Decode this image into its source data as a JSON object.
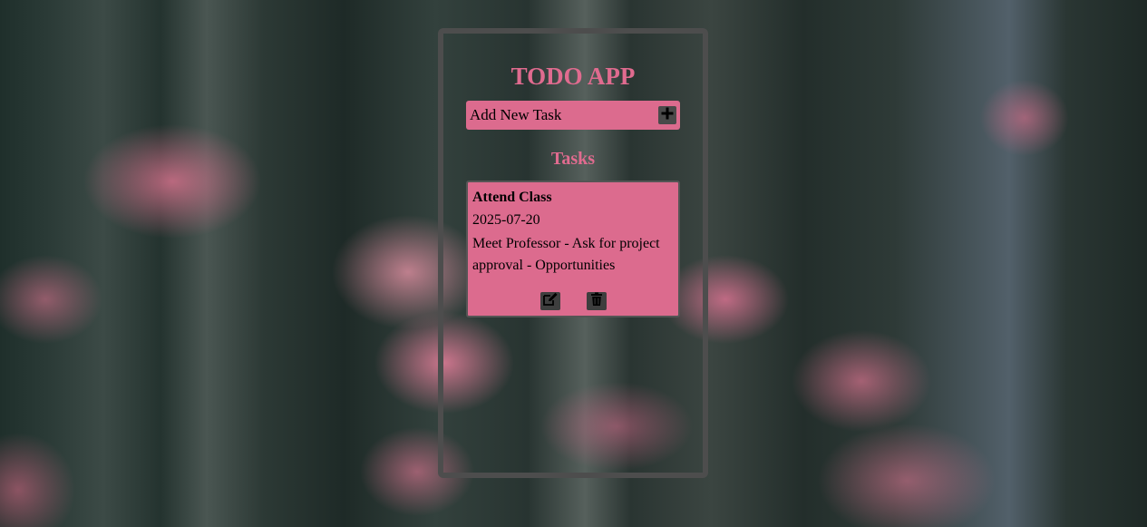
{
  "app": {
    "title": "TODO APP"
  },
  "add_task": {
    "placeholder": "Add New Task",
    "add_icon": "plus-icon"
  },
  "tasks_heading": "Tasks",
  "tasks": [
    {
      "title": "Attend Class",
      "date": "2025-07-20",
      "description": "Meet Professor - Ask for project approval - Opportunities",
      "edit_icon": "edit-icon",
      "delete_icon": "trash-icon"
    }
  ],
  "colors": {
    "accent": "#e06b8f",
    "card": "#dc6b8e",
    "border": "#4d4d4d",
    "icon_bg": "#3e3e3e"
  }
}
